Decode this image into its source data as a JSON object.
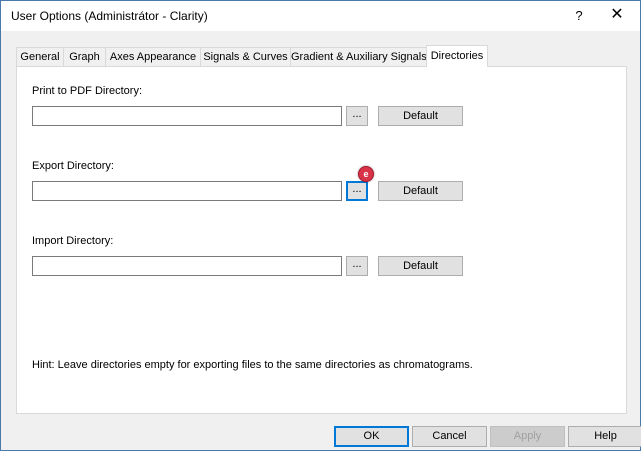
{
  "window": {
    "title": "User Options (Administrátor - Clarity)",
    "help_glyph": "?",
    "close_glyph": "✕"
  },
  "tabs": [
    {
      "label": "General"
    },
    {
      "label": "Graph"
    },
    {
      "label": "Axes Appearance"
    },
    {
      "label": "Signals & Curves"
    },
    {
      "label": "Gradient & Auxiliary Signals"
    },
    {
      "label": "Directories",
      "active": true
    }
  ],
  "directories": {
    "print_pdf": {
      "label": "Print to PDF Directory:",
      "value": "",
      "browse": "...",
      "default": "Default"
    },
    "export": {
      "label": "Export Directory:",
      "value": "",
      "browse": "...",
      "default": "Default"
    },
    "import": {
      "label": "Import Directory:",
      "value": "",
      "browse": "...",
      "default": "Default"
    },
    "badge": "e"
  },
  "hint": "Hint: Leave directories empty for exporting files to the same directories as chromatograms.",
  "footer": {
    "ok": "OK",
    "cancel": "Cancel",
    "apply": "Apply",
    "help": "Help"
  },
  "colors": {
    "accent": "#0078d7",
    "badge": "#d9334a"
  }
}
